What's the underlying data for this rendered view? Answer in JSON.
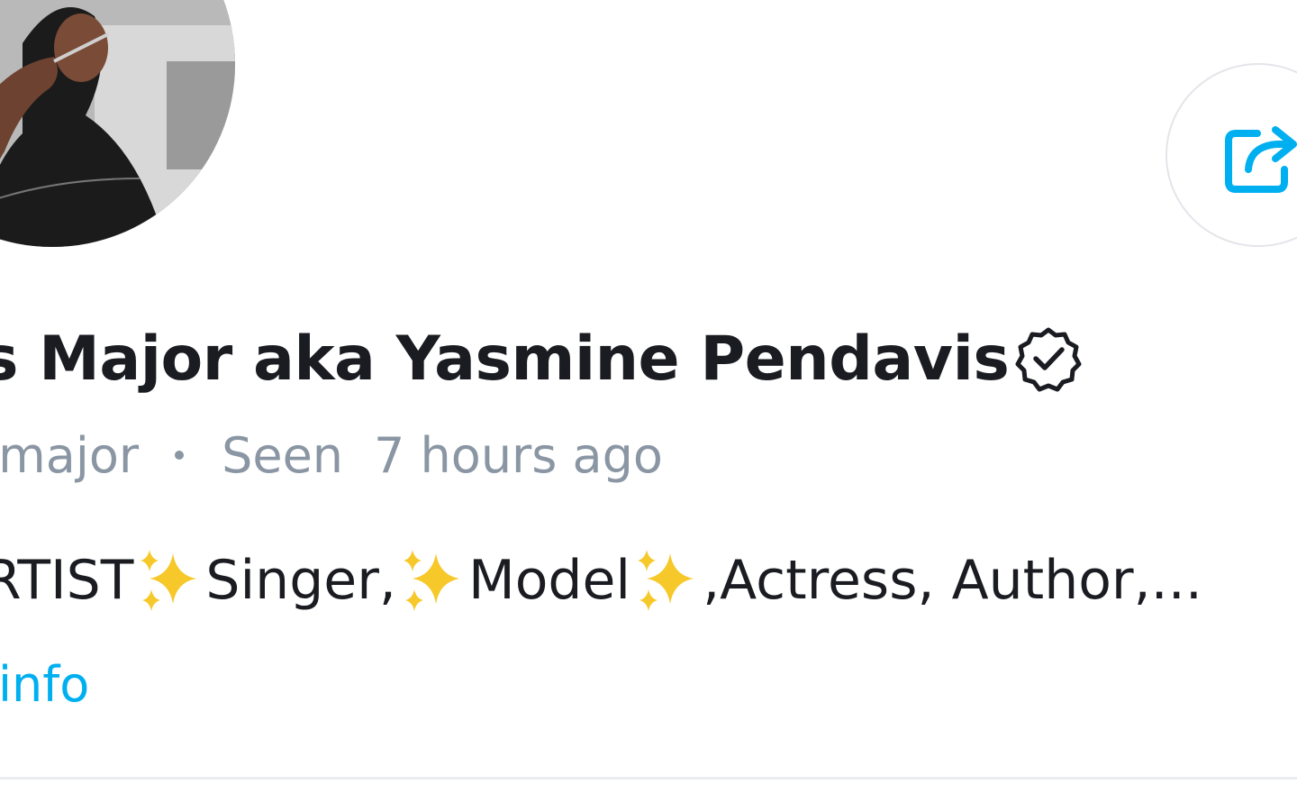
{
  "profile": {
    "name": "s Major aka Yasmine Pendavis",
    "handle": "smajor",
    "seen_label": "Seen",
    "seen_time": "7 hours ago",
    "bio_parts": [
      "RTIST ",
      "Singer,",
      "Model",
      ",Actress, Author,..."
    ],
    "more_info": "info",
    "verified_icon": "verified-badge-icon",
    "share_icon": "share-icon"
  },
  "colors": {
    "accent": "#00aff0",
    "text_primary": "#1a1c22",
    "text_muted": "#8a96a3",
    "sparkle": "#f7c82a"
  }
}
